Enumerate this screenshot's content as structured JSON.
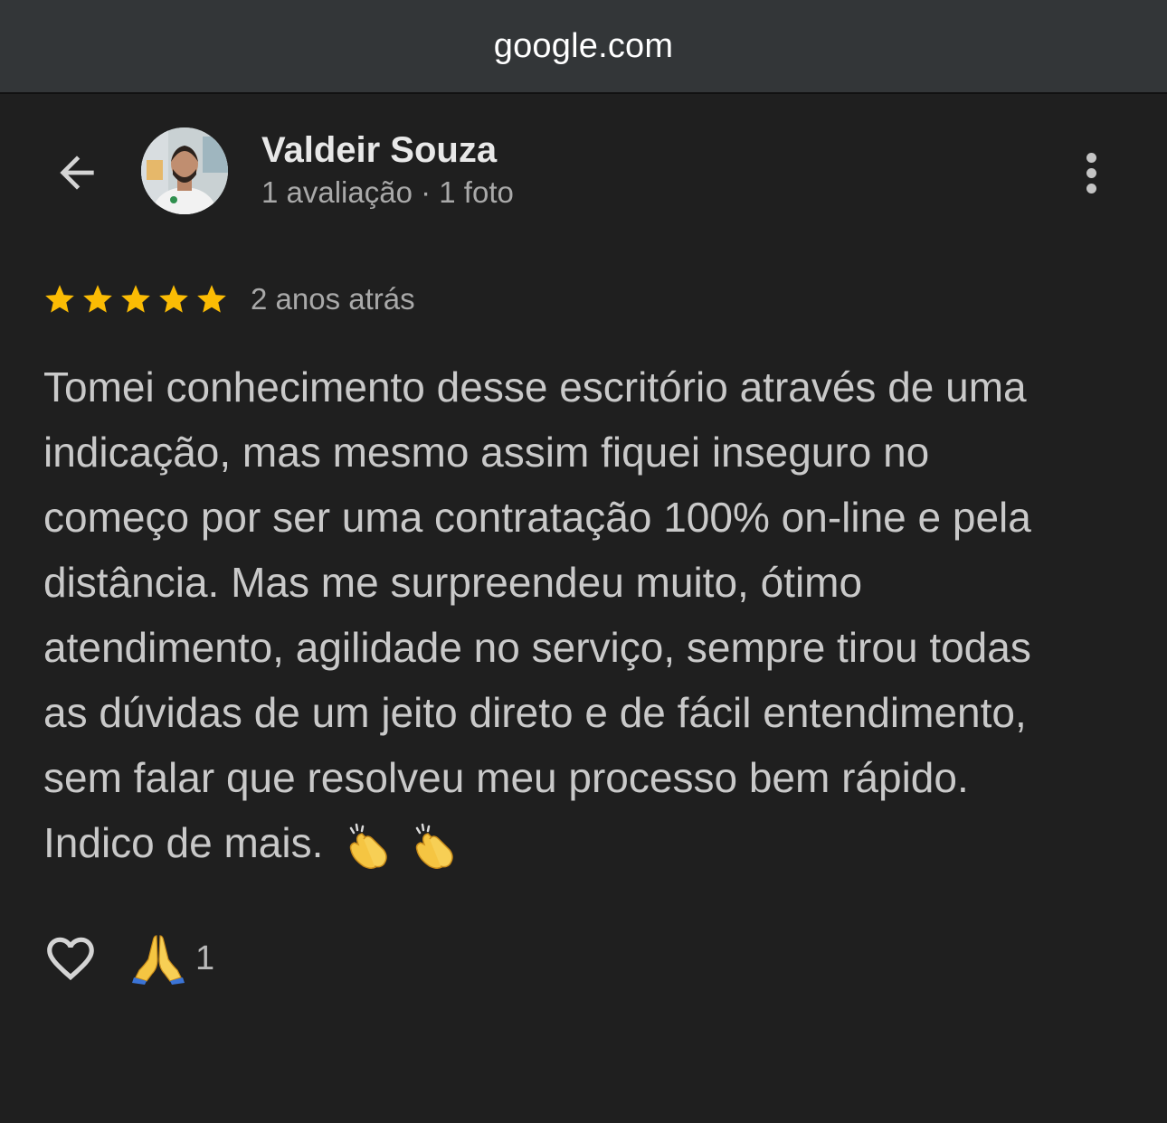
{
  "browser": {
    "url": "google.com"
  },
  "header": {
    "back_icon": "arrow-back-icon",
    "author_name": "Valdeir Souza",
    "author_meta": "1 avaliação · 1 foto",
    "more_icon": "more-vert-icon"
  },
  "review": {
    "rating": 5,
    "rating_max": 5,
    "star_color": "#fbbc04",
    "date": "2 anos atrás",
    "text_lines": [
      "Tomei conhecimento desse escritório através de uma",
      "indicação, mas mesmo assim fiquei inseguro no",
      "começo por ser uma contratação 100% on-line e pela",
      "distância. Mas me surpreendeu muito, ótimo",
      "atendimento, agilidade no serviço, sempre tirou todas",
      "as dúvidas de um jeito direto e de fácil entendimento,",
      "sem falar que resolveu meu processo bem rápido.",
      "Indico de mais."
    ],
    "emojis": [
      "clapping-hands-icon",
      "clapping-hands-icon"
    ]
  },
  "actions": {
    "like_icon": "heart-outline-icon",
    "reaction_icon": "folded-hands-icon",
    "reaction_count": "1"
  }
}
